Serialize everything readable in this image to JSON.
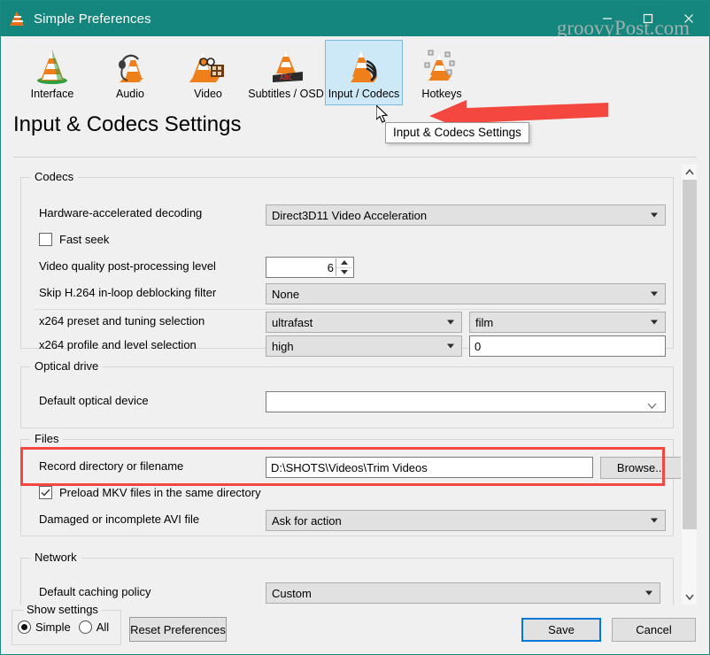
{
  "window": {
    "title": "Simple Preferences",
    "app_icon": "vlc-cone-icon",
    "titlebar_color": "#14867d",
    "watermark": "groovyPost.com",
    "controls": {
      "minimize": "minimize-icon",
      "maximize": "maximize-icon",
      "close": "close-icon"
    }
  },
  "toolbar": {
    "items": [
      {
        "label": "Interface",
        "icon": "vlc-cone-interface-icon",
        "selected": false
      },
      {
        "label": "Audio",
        "icon": "vlc-cone-headphones-icon",
        "selected": false
      },
      {
        "label": "Video",
        "icon": "vlc-cone-film-icon",
        "selected": false
      },
      {
        "label": "Subtitles / OSD",
        "icon": "vlc-cone-subtitles-icon",
        "selected": false
      },
      {
        "label": "Input / Codecs",
        "icon": "vlc-cone-cables-icon",
        "selected": true
      },
      {
        "label": "Hotkeys",
        "icon": "vlc-cone-keys-icon",
        "selected": false
      }
    ],
    "selected_index": 4,
    "selection_color": "#cde8f7"
  },
  "page": {
    "heading": "Input & Codecs Settings",
    "tooltip": "Input & Codecs Settings"
  },
  "annotation": {
    "arrow_color": "#f4473f",
    "highlight_color": "#f4473f"
  },
  "sections": {
    "codecs": {
      "legend": "Codecs",
      "hardware_decoding": {
        "label": "Hardware-accelerated decoding",
        "value": "Direct3D11 Video Acceleration"
      },
      "fast_seek": {
        "label": "Fast seek",
        "checked": false
      },
      "post_processing": {
        "label": "Video quality post-processing level",
        "value": "6"
      },
      "skip_deblocking": {
        "label": "Skip H.264 in-loop deblocking filter",
        "value": "None"
      },
      "x264_preset": {
        "label": "x264 preset and tuning selection",
        "value": "ultrafast",
        "tuning_value": "film"
      },
      "x264_profile": {
        "label": "x264 profile and level selection",
        "value": "high",
        "level_value": "0"
      }
    },
    "optical_drive": {
      "legend": "Optical drive",
      "default_device": {
        "label": "Default optical device",
        "value": ""
      }
    },
    "files": {
      "legend": "Files",
      "record_directory": {
        "label": "Record directory or filename",
        "value": "D:\\SHOTS\\Videos\\Trim Videos",
        "browse_label": "Browse..."
      },
      "preload_mkv": {
        "label": "Preload MKV files in the same directory",
        "checked": true
      },
      "damaged_avi": {
        "label": "Damaged or incomplete AVI file",
        "value": "Ask for action"
      }
    },
    "network": {
      "legend": "Network",
      "caching_policy": {
        "label": "Default caching policy",
        "value": "Custom"
      }
    }
  },
  "footer": {
    "show_settings": {
      "legend": "Show settings",
      "simple_label": "Simple",
      "all_label": "All",
      "selected": "Simple"
    },
    "reset_label": "Reset Preferences",
    "save_label": "Save",
    "cancel_label": "Cancel"
  }
}
